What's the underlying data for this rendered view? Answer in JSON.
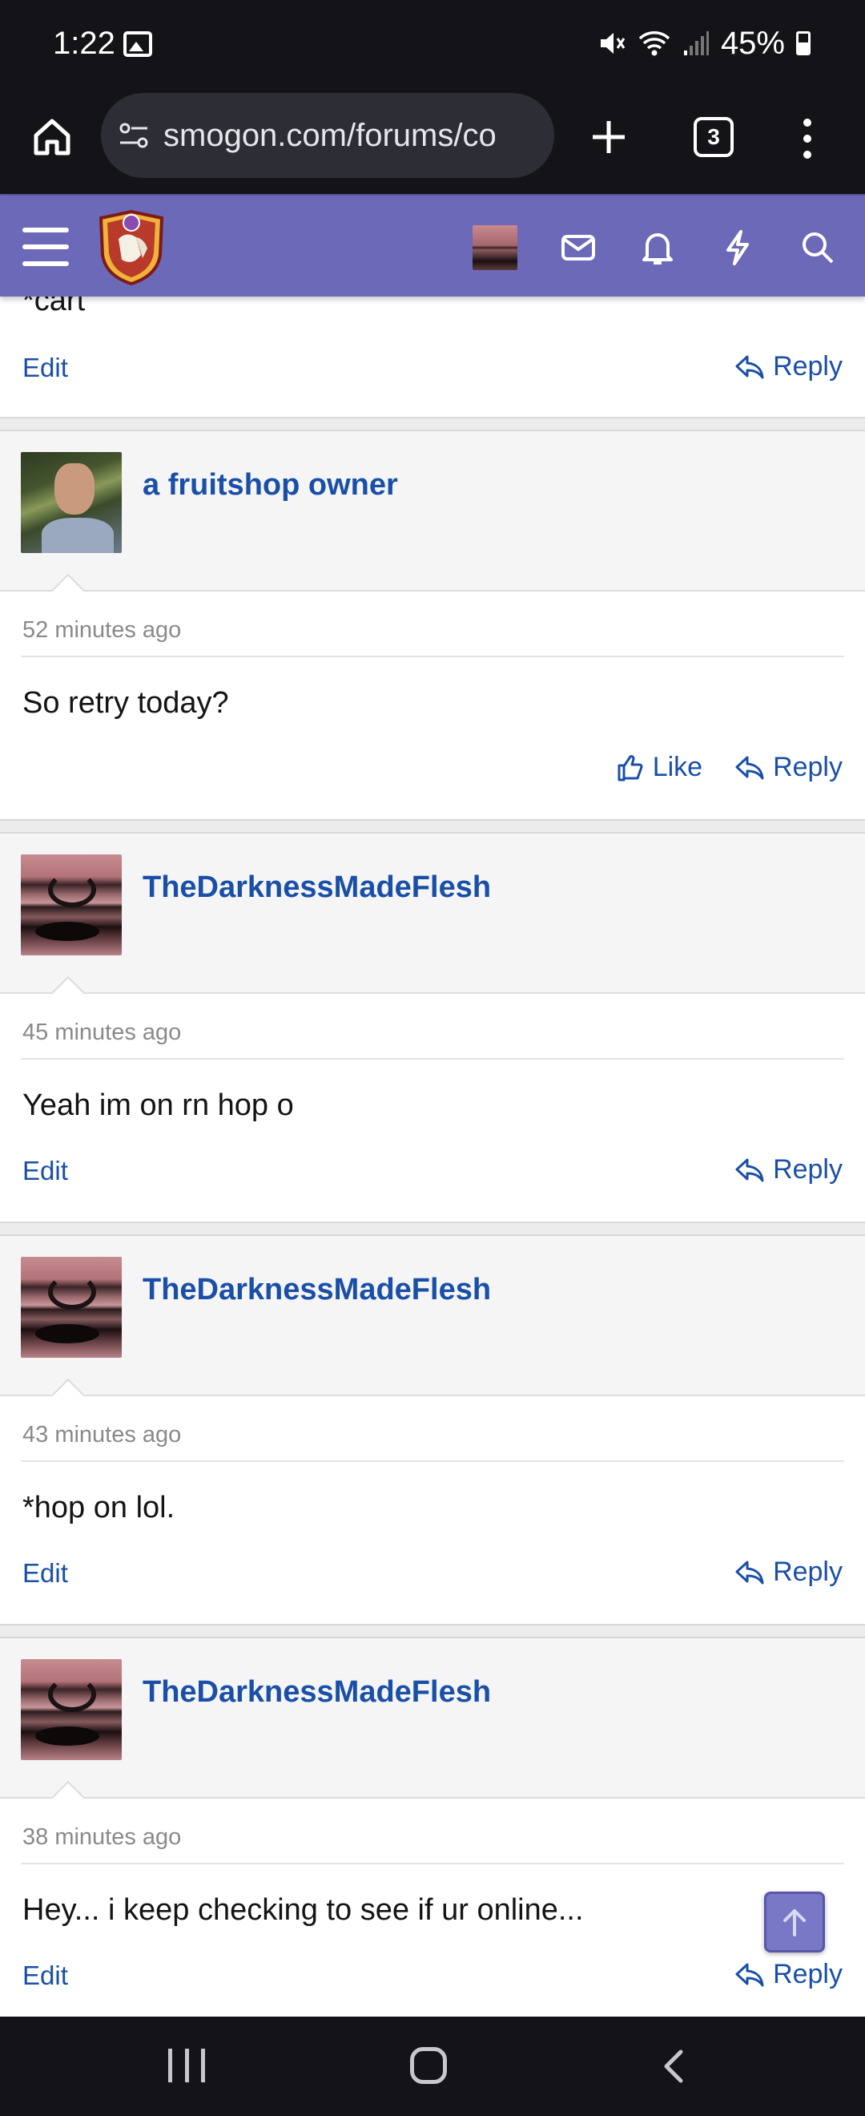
{
  "status_bar": {
    "time": "1:22",
    "battery": "45%"
  },
  "browser": {
    "url": "smogon.com/forums/co",
    "tab_count": "3"
  },
  "top_fragment": {
    "text": "*cart",
    "edit_label": "Edit",
    "reply_label": "Reply"
  },
  "posts": [
    {
      "username": "a fruitshop owner",
      "time": "52 minutes ago",
      "message": "So retry today?",
      "like_label": "Like",
      "reply_label": "Reply"
    },
    {
      "username": "TheDarknessMadeFlesh",
      "time": "45 minutes ago",
      "message": "Yeah im on rn hop o",
      "edit_label": "Edit",
      "reply_label": "Reply"
    },
    {
      "username": "TheDarknessMadeFlesh",
      "time": "43 minutes ago",
      "message": "*hop on lol.",
      "edit_label": "Edit",
      "reply_label": "Reply"
    },
    {
      "username": "TheDarknessMadeFlesh",
      "time": "38 minutes ago",
      "message": "Hey... i keep checking to see if ur online...",
      "edit_label": "Edit",
      "reply_label": "Reply"
    }
  ],
  "colors": {
    "header_bg": "#6b69b8",
    "link": "#1a4fa8",
    "system_bar": "#141418"
  },
  "icons": [
    "home-icon",
    "site-settings-icon",
    "plus-icon",
    "more-vert-icon",
    "hamburger-icon",
    "mail-icon",
    "bell-icon",
    "bolt-icon",
    "search-icon",
    "reply-icon",
    "thumbs-up-icon",
    "arrow-up-icon"
  ]
}
